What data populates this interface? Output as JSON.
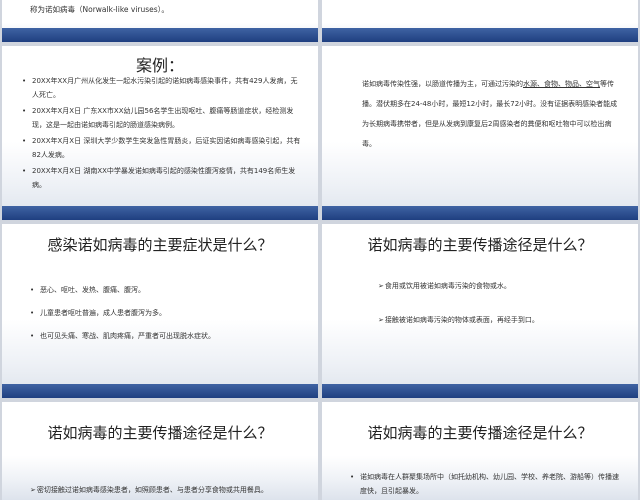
{
  "slide1": {
    "fragment": "称为诺如病毒（Norwalk-like viruses）。"
  },
  "slide3": {
    "title": "案例：",
    "items": [
      "20XX年XX月广州从化发生一起水污染引起的诺如病毒感染事件，共有429人发病，无人死亡。",
      "20XX年X月X日 广东XX市XX幼儿园56名学生出现呕吐、腹痛等肠道症状，经检测发现，这是一起由诺如病毒引起的肠道感染病例。",
      "20XX年X月X日 深圳大学少数学生突发急性胃肠炎，后证实因诺如病毒感染引起，共有82人发病。",
      "20XX年X月X日 湖南XX中学暴发诺如病毒引起的感染性腹泻疫情，共有149名师生发病。"
    ]
  },
  "slide4": {
    "text_a": "诺如病毒传染性强，以肠道传播为主，可通过污染的",
    "text_b": "水源、食物、物品、空气",
    "text_c": "等传播。潜伏期多在24-48小时，最短12小时，最长72小时。没有证据表明感染者能成为长期病毒携带者，但是从发病到康复后2周感染者的粪便和呕吐物中可以检出病毒。"
  },
  "slide5": {
    "title": "感染诺如病毒的主要症状是什么？",
    "items": [
      "恶心、呕吐、发热、腹痛、腹泻。",
      "儿童患者呕吐普遍，成人患者腹泻为多。",
      "也可见头痛、寒战、肌肉疼痛，严重者可出现脱水症状。"
    ]
  },
  "slide6": {
    "title": "诺如病毒的主要传播途径是什么？",
    "items": [
      "食用或饮用被诺如病毒污染的食物或水。",
      "接触被诺如病毒污染的物体或表面，再经手到口。"
    ]
  },
  "slide7": {
    "title": "诺如病毒的主要传播途径是什么？",
    "items": [
      "密切接触过诺如病毒感染患者，如照顾患者、与患者分享食物或共用餐具。"
    ]
  },
  "slide8": {
    "title": "诺如病毒的主要传播途径是什么？",
    "items": [
      "诺如病毒在人群聚集场所中（如托幼机构、幼儿园、学校、养老院、游船等）传播速度快，且引起暴发。"
    ]
  }
}
